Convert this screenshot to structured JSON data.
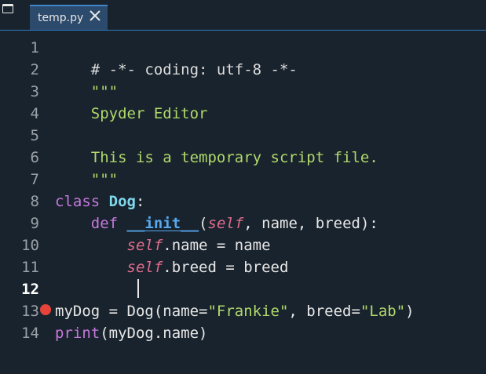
{
  "tabbar": {
    "tab_label": "temp.py",
    "accent_color": "#2f7bbf"
  },
  "gutter": {
    "line_numbers": [
      "1",
      "2",
      "3",
      "4",
      "5",
      "6",
      "7",
      "8",
      "9",
      "10",
      "11",
      "12",
      "13",
      "14"
    ],
    "current_line": "12",
    "breakpoint_line": "13",
    "breakpoint_color": "#e8433a"
  },
  "code": {
    "l1": "# -*- coding: utf-8 -*-",
    "l2": "\"\"\"",
    "l3": "Spyder Editor",
    "l5": "This is a temporary script file.",
    "l6": "\"\"\"",
    "l8_kw": "class",
    "l8_name": "Dog",
    "l8_rest": ":",
    "l9_kw": "def",
    "l9_name": "__init__",
    "l9_a": "(",
    "l9_self": "self",
    "l9_b": ", name, breed):",
    "l10_self": "self",
    "l10_rest": ".name = name",
    "l11_self": "self",
    "l11_rest": ".breed = breed",
    "l13_a": "myDog = Dog(name=",
    "l13_s1": "\"Frankie\"",
    "l13_b": ", breed=",
    "l13_s2": "\"Lab\"",
    "l13_c": ")",
    "l14_fn": "print",
    "l14_rest": "(myDog.name)"
  }
}
